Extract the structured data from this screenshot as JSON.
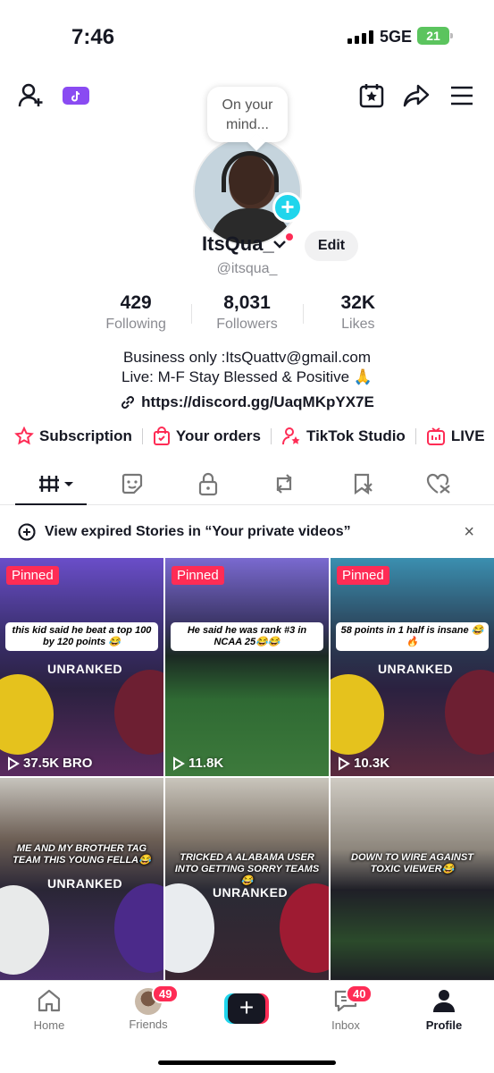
{
  "status_bar": {
    "time": "7:46",
    "network": "5GE",
    "battery": "21"
  },
  "profile": {
    "bubble_text": "On your mind...",
    "username": "ItsQua_",
    "edit_label": "Edit",
    "handle": "@itsqua_",
    "stats": [
      {
        "value": "429",
        "label": "Following"
      },
      {
        "value": "8,031",
        "label": "Followers"
      },
      {
        "value": "32K",
        "label": "Likes"
      }
    ],
    "bio_line1": "Business only :ItsQuattv@gmail.com",
    "bio_line2": "Live: M-F Stay Blessed & Positive 🙏",
    "link": "https://discord.gg/UaqMKpYX7E"
  },
  "shortcuts": [
    "Subscription",
    "Your orders",
    "TikTok Studio",
    "LIVE"
  ],
  "notice": {
    "text": "View expired Stories in “Your private videos”",
    "close": "×"
  },
  "videos": [
    {
      "pinned": "Pinned",
      "caption": "this kid said he beat a top 100 by 120 points 😂",
      "overlay": "UNRANKED",
      "views": "37.5K",
      "extra": "BRO"
    },
    {
      "pinned": "Pinned",
      "caption": "He said he was rank #3 in NCAA 25😂😂",
      "overlay": "",
      "views": "11.8K",
      "extra": ""
    },
    {
      "pinned": "Pinned",
      "caption": "58 points in 1 half is insane 😂🔥",
      "overlay": "UNRANKED",
      "views": "10.3K",
      "extra": ""
    },
    {
      "pinned": "",
      "caption": "ME AND MY BROTHER TAG TEAM THIS YOUNG FELLA😂",
      "overlay": "UNRANKED",
      "views": "",
      "extra": ""
    },
    {
      "pinned": "",
      "caption": "TRICKED A ALABAMA USER INTO GETTING SORRY TEAMS 😂",
      "overlay": "UNRANKED",
      "views": "",
      "extra": ""
    },
    {
      "pinned": "",
      "caption": "DOWN TO WIRE AGAINST TOXIC VIEWER😂",
      "overlay": "",
      "views": "",
      "extra": ""
    }
  ],
  "bottom_nav": {
    "home": "Home",
    "friends": "Friends",
    "friends_badge": "49",
    "inbox": "Inbox",
    "inbox_badge": "40",
    "profile": "Profile",
    "create": "+"
  },
  "colors": {
    "accent_red": "#fe2c55",
    "accent_cyan": "#20d5ec",
    "battery_green": "#5bc45e"
  }
}
